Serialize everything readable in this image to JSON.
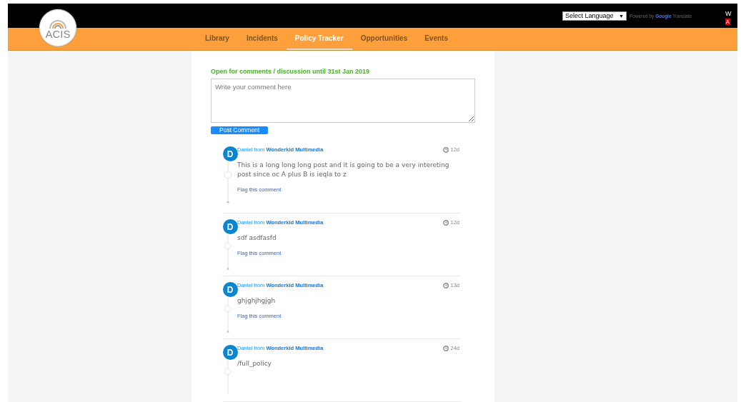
{
  "header": {
    "logo_text": "ACIS",
    "language_select": {
      "value": "Select Language",
      "caret": "▼"
    },
    "powered_by": {
      "prefix": "Powered by",
      "brand": "Google",
      "suffix": "Translate"
    },
    "cut_text": "W",
    "cut_badge": "A"
  },
  "nav": [
    {
      "label": "Library",
      "selected": false
    },
    {
      "label": "Incidents",
      "selected": false
    },
    {
      "label": "Policy Tracker",
      "selected": true
    },
    {
      "label": "Opportunities",
      "selected": false
    },
    {
      "label": "Events",
      "selected": false
    }
  ],
  "discussion": {
    "notice": "Open for comments / discussion until 31st Jan 2019",
    "comment_field": {
      "placeholder": "Write your comment here"
    },
    "post_button": "Post Comment"
  },
  "comments": [
    {
      "avatar": "D",
      "author": "Daniel from **Wonderkid Multimedia**",
      "age": "12d",
      "text": "This is a long long long post and it is going to be a very intereting post since oc A plus B is ieqla to z",
      "flag": "Flag this comment"
    },
    {
      "avatar": "D",
      "author": "Daniel from **Wonderkid Multimedia**",
      "age": "12d",
      "text": "sdf asdfasfd",
      "flag": "Flag this comment"
    },
    {
      "avatar": "D",
      "author": "Daniel from **Wonderkid Multimedia**",
      "age": "13d",
      "text": "ghjghjhgjgh",
      "flag": "Flag this comment"
    },
    {
      "avatar": "D",
      "author": "Daniel from **Wonderkid Multimedia**",
      "age": "24d",
      "text": "/full_policy"
    }
  ]
}
